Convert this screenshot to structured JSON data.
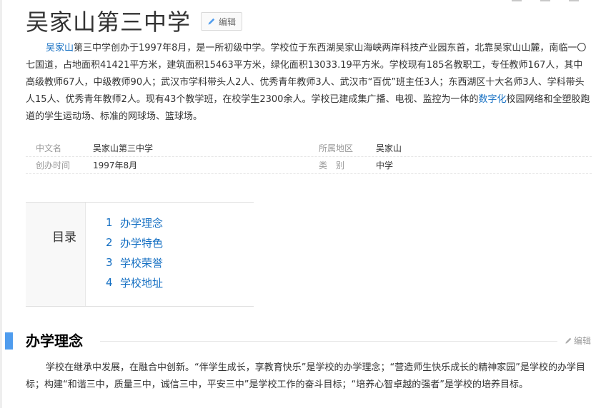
{
  "page_title": "吴家山第三中学",
  "edit_label": "编辑",
  "summary": {
    "link1": "吴家山",
    "text1": "第三中学创办于1997年8月，是一所初级中学。学校位于东西湖吴家山海峡两岸科技产业园东首，北靠吴家山山麓，南临一〇七国道，占地面积41421平方米，建筑面积15463平方米，绿化面积13033.19平方米。学校现有185名教职工，专任教师167人，其中高级教师67人，中级教师90人；武汉市学科带头人2人、优秀青年教师3人、武汉市“百优”班主任3人；东西湖区十大名师3人、学科带头人15人、优秀青年教师2人。现有43个教学班，在校学生2300余人。学校已建成集广播、电视、监控为一体的",
    "link2": "数字化",
    "text2": "校园网络和全塑胶跑道的学生运动场、标准的网球场、篮球场。"
  },
  "basic_info": [
    {
      "label": "中文名",
      "value": "吴家山第三中学",
      "label2": "所属地区",
      "value2": "吴家山"
    },
    {
      "label": "创办时间",
      "value": "1997年8月",
      "label2": "类　别",
      "value2": "中学"
    }
  ],
  "toc": {
    "title": "目录",
    "items": [
      {
        "num": "1",
        "label": "办学理念"
      },
      {
        "num": "2",
        "label": "办学特色"
      },
      {
        "num": "3",
        "label": "学校荣誉"
      },
      {
        "num": "4",
        "label": "学校地址"
      }
    ]
  },
  "section1": {
    "title": "办学理念",
    "edit_label": "编辑",
    "text": "学校在继承中发展，在融合中创新。“伴学生成长，享教育快乐”是学校的办学理念；“营造师生快乐成长的精神家园”是学校的办学目标；构建“和谐三中，质量三中，诚信三中，平安三中”是学校工作的奋斗目标；“培养心智卓越的强者”是学校的培养目标。"
  },
  "colors": {
    "link": "#136ec2",
    "section_bar": "#4f9cee",
    "label_gray": "#999999"
  },
  "icons": [
    "pencil-icon"
  ]
}
